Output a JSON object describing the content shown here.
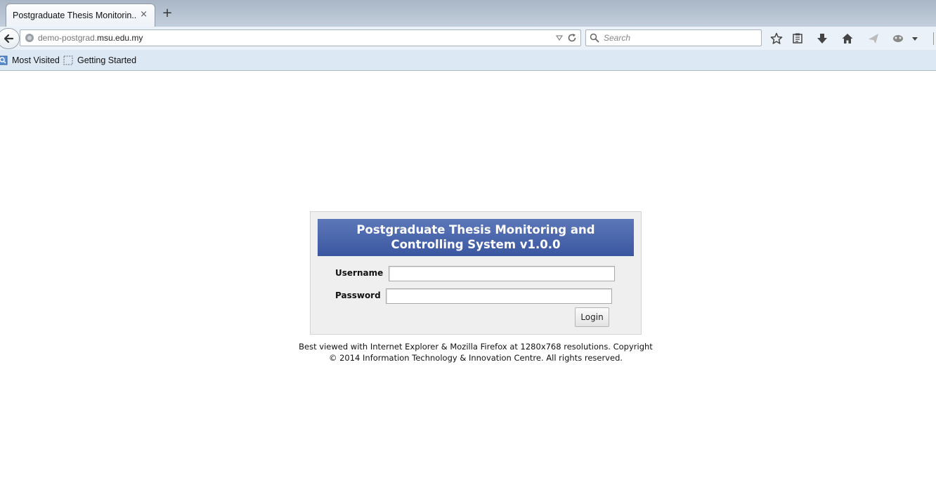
{
  "browser": {
    "tab_title": "Postgraduate Thesis Monitorin...",
    "tab_close": "×",
    "new_tab": "+",
    "url_prefix": "demo-postgrad.",
    "url_domain": "msu.edu.my",
    "search_placeholder": "Search",
    "bookmarks": [
      {
        "label": "Most Visited"
      },
      {
        "label": "Getting Started"
      }
    ]
  },
  "login": {
    "title_line1": "Postgraduate Thesis Monitoring and",
    "title_line2": "Controlling System v1.0.0",
    "username_label": "Username",
    "username_value": "",
    "password_label": "Password",
    "password_value": "",
    "login_button": "Login"
  },
  "footer": {
    "line1": "Best viewed with Internet Explorer & Mozilla Firefox at 1280x768 resolutions. Copyright",
    "line2": "© 2014 Information Technology & Innovation Centre. All rights reserved."
  },
  "colors": {
    "header_blue": "#4865ac",
    "chrome_bg": "#eaf1f8"
  }
}
